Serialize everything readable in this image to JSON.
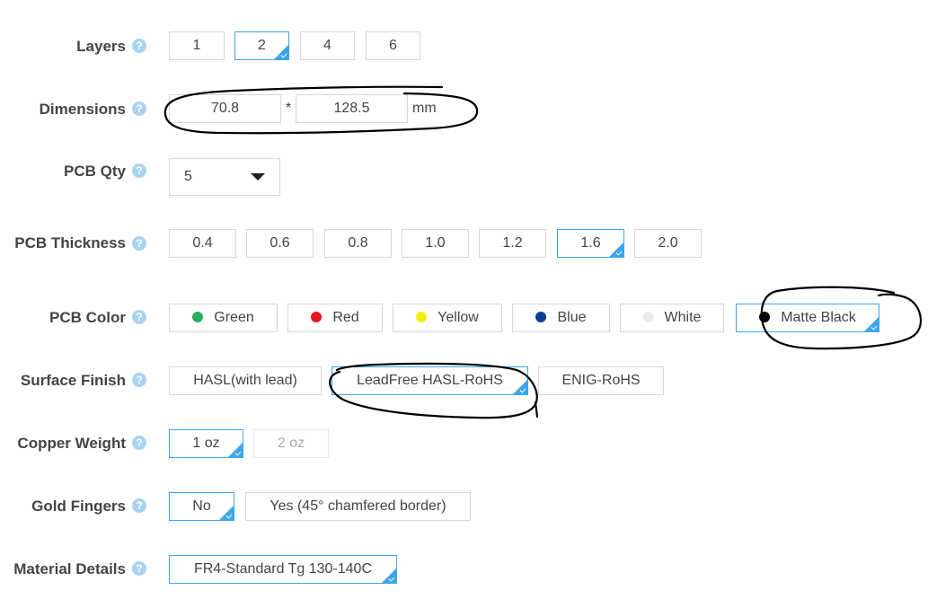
{
  "help_glyph": "?",
  "layers": {
    "label": "Layers",
    "options": [
      "1",
      "2",
      "4",
      "6"
    ],
    "selected": "2"
  },
  "dimensions": {
    "label": "Dimensions",
    "width": "70.8",
    "separator": "*",
    "height": "128.5",
    "unit": "mm"
  },
  "pcb_qty": {
    "label": "PCB Qty",
    "value": "5"
  },
  "pcb_thickness": {
    "label": "PCB Thickness",
    "options": [
      "0.4",
      "0.6",
      "0.8",
      "1.0",
      "1.2",
      "1.6",
      "2.0"
    ],
    "selected": "1.6"
  },
  "pcb_color": {
    "label": "PCB Color",
    "options": [
      {
        "name": "Green",
        "color": "#27ae60"
      },
      {
        "name": "Red",
        "color": "#e8141e"
      },
      {
        "name": "Yellow",
        "color": "#f5ee10"
      },
      {
        "name": "Blue",
        "color": "#0a3f95"
      },
      {
        "name": "White",
        "color": "#ebebeb"
      },
      {
        "name": "Matte Black",
        "color": "#000000"
      }
    ],
    "selected": "Matte Black"
  },
  "surface_finish": {
    "label": "Surface Finish",
    "options": [
      "HASL(with lead)",
      "LeadFree HASL-RoHS",
      "ENIG-RoHS"
    ],
    "selected": "LeadFree HASL-RoHS"
  },
  "copper_weight": {
    "label": "Copper Weight",
    "options": [
      "1 oz",
      "2 oz"
    ],
    "selected": "1 oz",
    "disabled": [
      "2 oz"
    ]
  },
  "gold_fingers": {
    "label": "Gold Fingers",
    "options": [
      "No",
      "Yes (45° chamfered border)"
    ],
    "selected": "No"
  },
  "material_details": {
    "label": "Material Details",
    "options": [
      "FR4-Standard Tg 130-140C"
    ],
    "selected": "FR4-Standard Tg 130-140C"
  },
  "accent_color": "#3da5ec"
}
